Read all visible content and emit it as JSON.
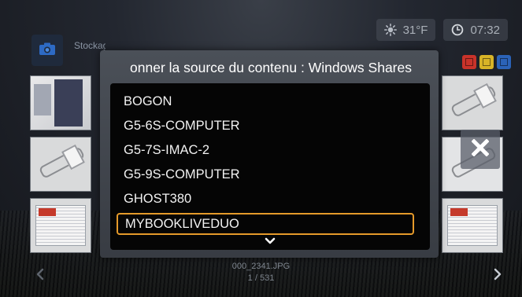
{
  "status_bar": {
    "weather_icon": "sun-icon",
    "temperature": "31°F",
    "clock_icon": "clock-icon",
    "time": "07:32"
  },
  "storage": {
    "camera_icon": "camera-icon",
    "label": "Stockage interne"
  },
  "color_keys": [
    {
      "name": "red",
      "color": "#c8332a"
    },
    {
      "name": "yellow",
      "color": "#d8b427"
    },
    {
      "name": "blue",
      "color": "#2b63b8"
    }
  ],
  "dialog": {
    "title": "onner la source du contenu : Windows Shares",
    "items": [
      {
        "label": "BOGON",
        "selected": false
      },
      {
        "label": "G5-6S-COMPUTER",
        "selected": false
      },
      {
        "label": "G5-7S-IMAC-2",
        "selected": false
      },
      {
        "label": "G5-9S-COMPUTER",
        "selected": false
      },
      {
        "label": "GHOST380",
        "selected": false
      },
      {
        "label": "MYBOOKLIVEDUO",
        "selected": true
      }
    ],
    "scroll_icon": "chevron-down-icon",
    "accent_color": "#e59a2a"
  },
  "close_icon": "close-icon",
  "footer": {
    "file_name": "000_2341.JPG",
    "file_count": "1 / 531",
    "prev_icon": "chevron-left-icon",
    "next_icon": "chevron-right-icon"
  }
}
